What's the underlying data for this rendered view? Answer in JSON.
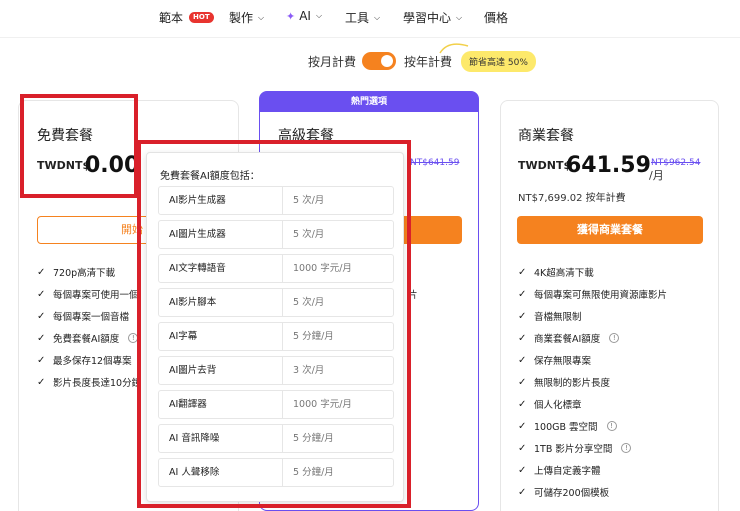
{
  "nav": {
    "items": [
      {
        "label": "範本",
        "badge": "HOT"
      },
      {
        "label": "製作"
      },
      {
        "label": "AI"
      },
      {
        "label": "工具"
      },
      {
        "label": "學習中心"
      },
      {
        "label": "價格"
      }
    ]
  },
  "billing_toggle": {
    "monthly_label": "按月計費",
    "yearly_label": "按年計費",
    "save_badge": "節省高達 50%",
    "state": "on"
  },
  "plans": {
    "free": {
      "name": "免費套餐",
      "currency": "TWDNT$",
      "price": "0.00",
      "button": "開始",
      "features": [
        "720p高清下載",
        "每個專案可使用一個",
        "每個專案一個音檔",
        "免費套餐AI額度",
        "最多保存12個專案",
        "影片長度長達10分鐘"
      ]
    },
    "pro": {
      "popular_label": "熱門選項",
      "name": "高級套餐",
      "strike_price": "NT$641.59",
      "partial_text": "片"
    },
    "business": {
      "name": "商業套餐",
      "currency": "TWDNT$",
      "price": "641.59",
      "per": "/月",
      "strike_price": "NT$962.54",
      "yearly_text": "NT$7,699.02 按年計費",
      "button": "獲得商業套餐",
      "features": [
        {
          "text": "4K超高清下載",
          "info": false
        },
        {
          "text": "每個專案可無限使用資源庫影片",
          "info": false
        },
        {
          "text": "音檔無限制",
          "info": false
        },
        {
          "text": "商業套餐AI額度",
          "info": true
        },
        {
          "text": "保存無限專案",
          "info": false
        },
        {
          "text": "無限制的影片長度",
          "info": false
        },
        {
          "text": "個人化標章",
          "info": false
        },
        {
          "text": "100GB 雲空間",
          "info": true
        },
        {
          "text": "1TB 影片分享空間",
          "info": true
        },
        {
          "text": "上傳自定義字體",
          "info": false
        },
        {
          "text": "可儲存200個模板",
          "info": false
        }
      ]
    }
  },
  "popover": {
    "title": "免費套餐AI額度包括：",
    "rows": [
      {
        "name": "AI影片生成器",
        "value": "5 次/月"
      },
      {
        "name": "AI圖片生成器",
        "value": "5 次/月"
      },
      {
        "name": "AI文字轉語音",
        "value": "1000 字元/月"
      },
      {
        "name": "AI影片腳本",
        "value": "5 次/月"
      },
      {
        "name": "AI字幕",
        "value": "5 分鐘/月"
      },
      {
        "name": "AI圖片去背",
        "value": "3 次/月"
      },
      {
        "name": "AI翻譯器",
        "value": "1000 字元/月"
      },
      {
        "name": "AI 音訊降噪",
        "value": "5 分鐘/月"
      },
      {
        "name": "AI 人聲移除",
        "value": "5 分鐘/月"
      }
    ]
  },
  "colors": {
    "accent": "#f5821f",
    "popular": "#6a4ff0",
    "highlight_box": "#d9202a",
    "badge_yellow": "#fde96b"
  }
}
